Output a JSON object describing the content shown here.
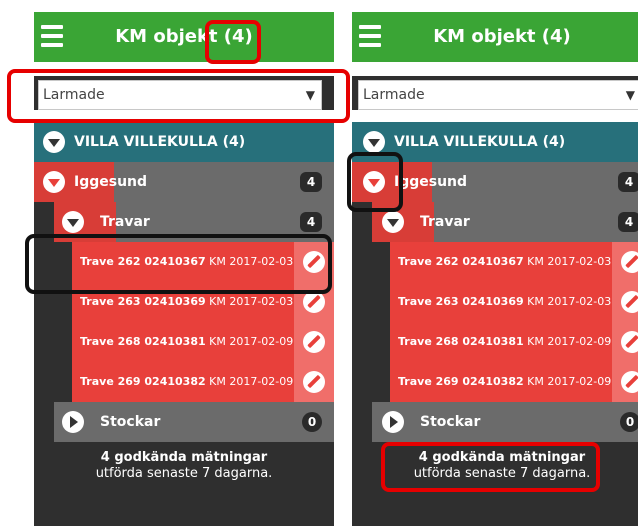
{
  "screens": [
    {
      "title": "KM objekt (4)",
      "filter": "Larmade",
      "group": {
        "label": "VILLA VILLEKULLA (4)"
      },
      "site": {
        "label": "Iggesund",
        "count": "4"
      },
      "category": {
        "label": "Travar",
        "count": "4"
      },
      "items": [
        {
          "name": "Trave 262 02410367",
          "meta": "KM 2017-02-03"
        },
        {
          "name": "Trave 263 02410369",
          "meta": "KM 2017-02-03"
        },
        {
          "name": "Trave 268 02410381",
          "meta": "KM 2017-02-09"
        },
        {
          "name": "Trave 269 02410382",
          "meta": "KM 2017-02-09"
        }
      ],
      "stockar": {
        "label": "Stockar",
        "count": "0"
      },
      "footer": {
        "line1": "4 godkända mätningar",
        "line2": "utförda senaste 7 dagarna."
      }
    },
    {
      "title": "KM objekt (4)",
      "filter": "Larmade",
      "group": {
        "label": "VILLA VILLEKULLA (4)"
      },
      "site": {
        "label": "Iggesund",
        "count": "4"
      },
      "category": {
        "label": "Travar",
        "count": "4"
      },
      "items": [
        {
          "name": "Trave 262 02410367",
          "meta": "KM 2017-02-03"
        },
        {
          "name": "Trave 263 02410369",
          "meta": "KM 2017-02-03"
        },
        {
          "name": "Trave 268 02410381",
          "meta": "KM 2017-02-09"
        },
        {
          "name": "Trave 269 02410382",
          "meta": "KM 2017-02-09"
        }
      ],
      "stockar": {
        "label": "Stockar",
        "count": "0"
      },
      "footer": {
        "line1": "4 godkända mätningar",
        "line2": "utförda senaste 7 dagarna."
      }
    }
  ],
  "colors": {
    "header": "#3aa535",
    "group": "#27707b",
    "item": "#e8403b",
    "annotation_red": "#e60000",
    "annotation_black": "#111111"
  }
}
